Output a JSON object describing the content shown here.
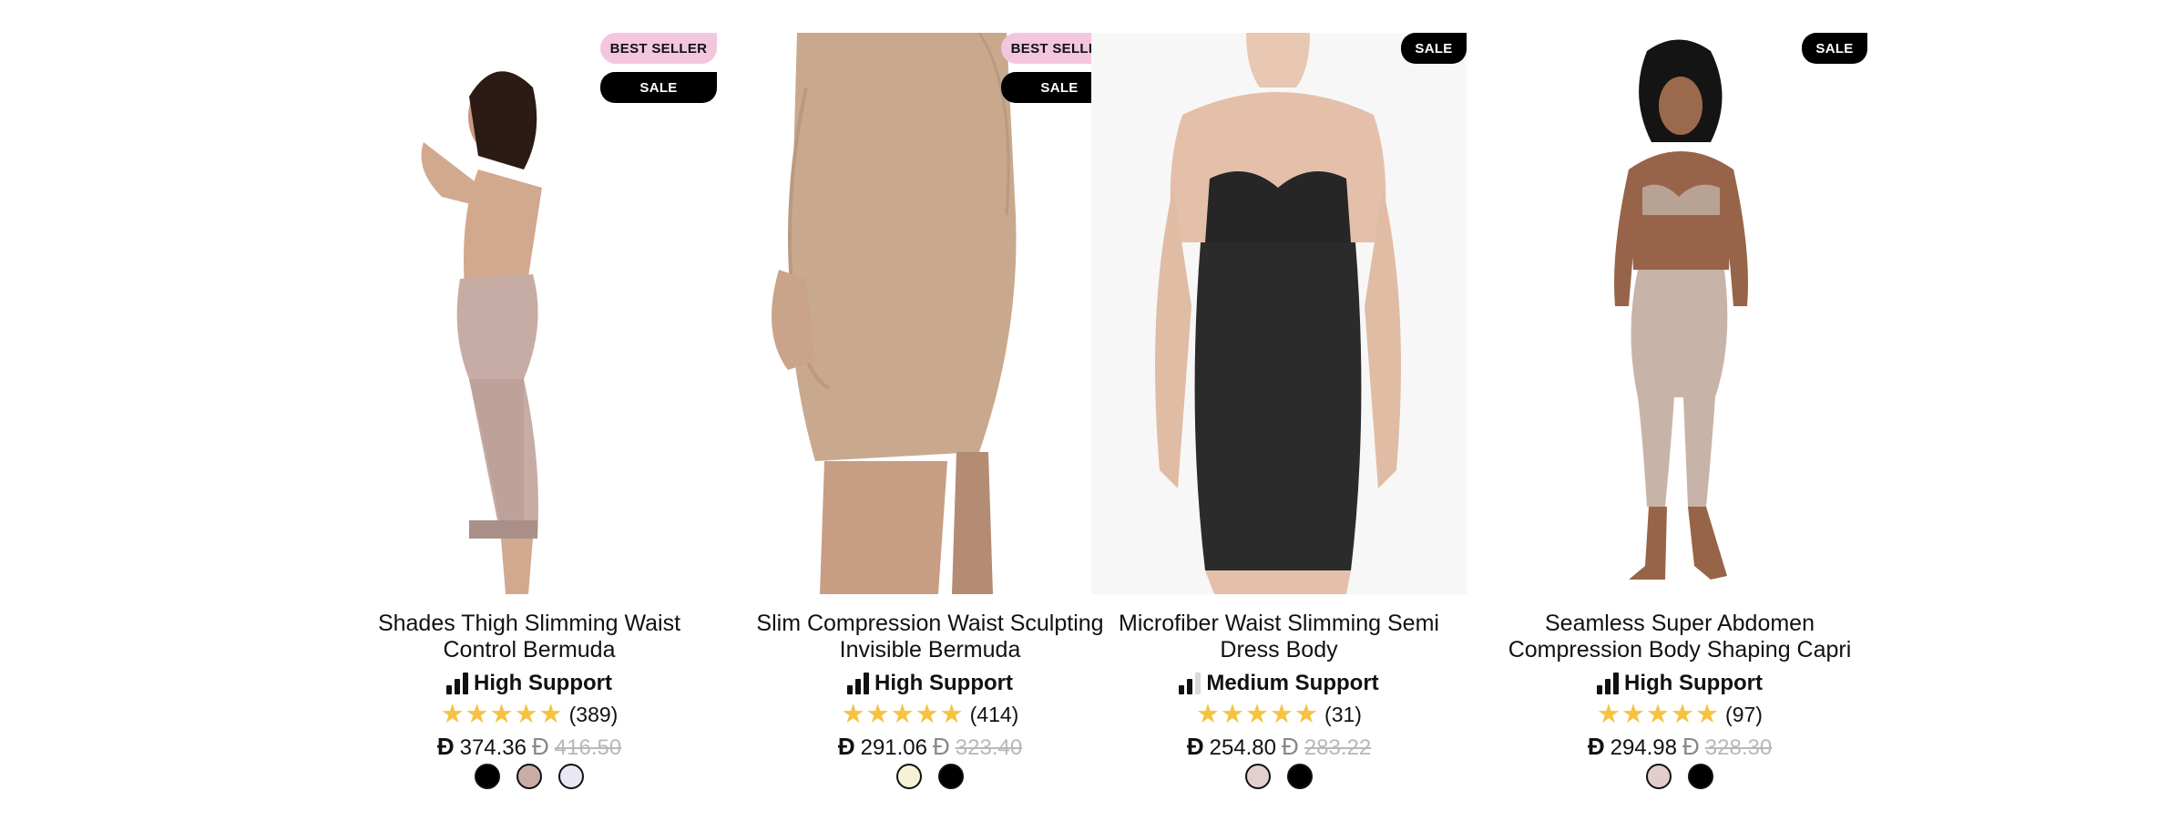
{
  "products": [
    {
      "name": "Shades Thigh Slimming Waist Control Bermuda",
      "badges": [
        "BEST SELLER",
        "SALE"
      ],
      "support": "High Support",
      "support_level": "high",
      "rating_stars": "★★★★★",
      "review_count": "(389)",
      "currency_symbol": "Đ",
      "price": "374.36",
      "old_price": "416.50",
      "swatches": [
        "#000000",
        "#c9aca4",
        "#e8e8f4"
      ]
    },
    {
      "name": "Slim Compression Waist Sculpting Invisible Bermuda",
      "badges": [
        "BEST SELLER",
        "SALE"
      ],
      "support": "High Support",
      "support_level": "high",
      "rating_stars": "★★★★★",
      "review_count": "(414)",
      "currency_symbol": "Đ",
      "price": "291.06",
      "old_price": "323.40",
      "swatches": [
        "#f7f1d6",
        "#000000"
      ]
    },
    {
      "name": "Microfiber Waist Slimming Semi Dress Body",
      "badges": [
        "SALE"
      ],
      "support": "Medium Support",
      "support_level": "medium",
      "rating_stars": "★★★★★",
      "review_count": "(31)",
      "currency_symbol": "Đ",
      "price": "254.80",
      "old_price": "283.22",
      "swatches": [
        "#e2cfcf",
        "#000000"
      ]
    },
    {
      "name": "Seamless Super Abdomen Compression Body Shaping Capri",
      "badges": [
        "SALE"
      ],
      "support": "High Support",
      "support_level": "high",
      "rating_stars": "★★★★★",
      "review_count": "(97)",
      "currency_symbol": "Đ",
      "price": "294.98",
      "old_price": "328.30",
      "swatches": [
        "#e2cccc",
        "#000000"
      ]
    }
  ],
  "colors": {
    "badge_best_seller": "#f4c6de",
    "badge_sale": "#000000",
    "star": "#f6c242",
    "old_price": "#b8b8b8"
  },
  "icons": {
    "support": "support-bars-icon",
    "rating": "star-icon"
  }
}
